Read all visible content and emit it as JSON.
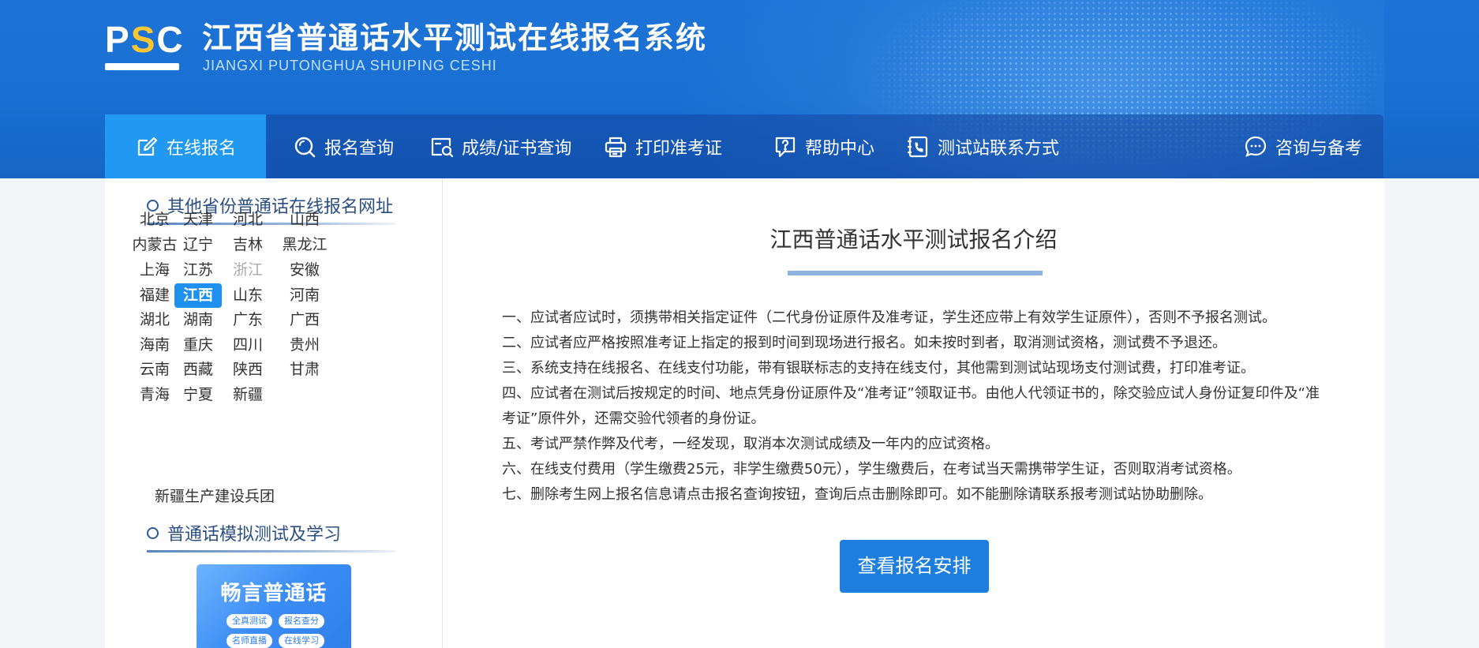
{
  "header": {
    "logo": {
      "p": "P",
      "s": "S",
      "c": "C"
    },
    "title": "江西省普通话水平测试在线报名系统",
    "subtitle": "JIANGXI PUTONGHUA SHUIPING CESHI"
  },
  "nav": {
    "items": [
      {
        "label": "在线报名",
        "icon": "edit-icon",
        "active": true
      },
      {
        "label": "报名查询",
        "icon": "search-icon"
      },
      {
        "label": "成绩/证书查询",
        "icon": "certificate-search-icon"
      },
      {
        "label": "打印准考证",
        "icon": "printer-icon"
      },
      {
        "label": "帮助中心",
        "icon": "help-icon"
      },
      {
        "label": "测试站联系方式",
        "icon": "phone-book-icon"
      },
      {
        "label": "咨询与备考",
        "icon": "chat-icon"
      }
    ]
  },
  "sidebar": {
    "provinces_heading": "其他省份普通话在线报名网址",
    "provinces": [
      "北京",
      "天津",
      "河北",
      "山西",
      "内蒙古",
      "辽宁",
      "吉林",
      "黑龙江",
      "上海",
      "江苏",
      "浙江",
      "安徽",
      "福建",
      "江西",
      "山东",
      "河南",
      "湖北",
      "湖南",
      "广东",
      "广西",
      "海南",
      "重庆",
      "四川",
      "贵州",
      "云南",
      "西藏",
      "陕西",
      "甘肃",
      "青海",
      "宁夏",
      "新疆"
    ],
    "active_province": "江西",
    "disabled_province": "浙江",
    "bingtuan": "新疆生产建设兵团",
    "practice_heading": "普通话模拟测试及学习",
    "promo": {
      "title": "畅言普通话",
      "tags": [
        "全真测试",
        "报名查分",
        "名师直播",
        "在线学习"
      ]
    }
  },
  "main": {
    "title": "江西普通话水平测试报名介绍",
    "rules": [
      "一、应试者应试时，须携带相关指定证件（二代身份证原件及准考证，学生还应带上有效学生证原件），否则不予报名测试。",
      "二、应试者应严格按照准考证上指定的报到时间到现场进行报名。如未按时到者，取消测试资格，测试费不予退还。",
      "三、系统支持在线报名、在线支付功能，带有银联标志的支持在线支付，其他需到测试站现场支付测试费，打印准考证。",
      "四、应试者在测试后按规定的时间、地点凭身份证原件及“准考证”领取证书。由他人代领证书的，除交验应试人身份证复印件及“准考证”原件外，还需交验代领者的身份证。",
      "五、考试严禁作弊及代考，一经发现，取消本次测试成绩及一年内的应试资格。",
      "六、在线支付费用（学生缴费25元，非学生缴费50元），学生缴费后，在考试当天需携带学生证，否则取消考试资格。",
      "七、删除考生网上报名信息请点击报名查询按钮，查询后点击删除即可。如不能删除请联系报考测试站协助删除。"
    ],
    "view_schedule_button": "查看报名安排"
  },
  "colors": {
    "header_blue": "#1d73d6",
    "nav_active": "#2199f3",
    "accent_yellow": "#ffc533",
    "button_blue": "#1d7ee0",
    "province_active": "#1e90f0"
  }
}
